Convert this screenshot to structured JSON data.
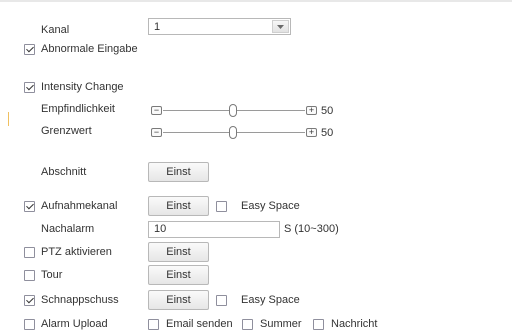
{
  "kanal": {
    "label": "Kanal",
    "value": "1"
  },
  "abnormale": {
    "label": "Abnormale Eingabe",
    "checked": true
  },
  "intensity": {
    "label": "Intensity Change",
    "checked": true
  },
  "empfindlichkeit": {
    "label": "Empfindlichkeit",
    "value": "50",
    "minus": "−",
    "plus": "+"
  },
  "grenzwert": {
    "label": "Grenzwert",
    "value": "50",
    "minus": "−",
    "plus": "+"
  },
  "abschnitt": {
    "label": "Abschnitt",
    "button": "Einst"
  },
  "aufnahmekanal": {
    "label": "Aufnahmekanal",
    "checked": true,
    "button": "Einst",
    "easy_space": "Easy Space"
  },
  "nachalarm": {
    "label": "Nachalarm",
    "value": "10",
    "unit": "S (10~300)"
  },
  "ptz": {
    "label": "PTZ aktivieren",
    "checked": false,
    "button": "Einst"
  },
  "tour": {
    "label": "Tour",
    "checked": false,
    "button": "Einst"
  },
  "schnappschuss": {
    "label": "Schnappschuss",
    "checked": true,
    "button": "Einst",
    "easy_space": "Easy Space"
  },
  "alarm_upload": {
    "label": "Alarm Upload",
    "checked": false
  },
  "email": {
    "label": "Email senden",
    "checked": false
  },
  "summer": {
    "label": "Summer",
    "checked": false
  },
  "nachricht": {
    "label": "Nachricht",
    "checked": false
  }
}
